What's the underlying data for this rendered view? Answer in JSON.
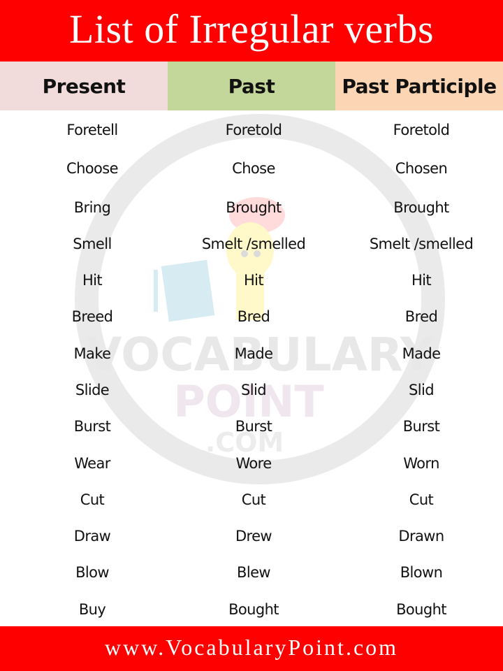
{
  "title": "List of Irregular verbs",
  "colors": {
    "banner_red": "#ff0000",
    "present_header_bg": "#f2dcdb",
    "past_header_bg": "#c4d79b",
    "past_participle_header_bg": "#fcd5b4"
  },
  "table": {
    "headers": [
      "Present",
      "Past",
      "Past Participle"
    ],
    "rows": [
      [
        "Foretell",
        "Foretold",
        "Foretold"
      ],
      [
        "Choose",
        "Chose",
        "Chosen"
      ],
      [
        "Bring",
        "Brought",
        "Brought"
      ],
      [
        "Smell",
        "Smelt /smelled",
        "Smelt /smelled"
      ],
      [
        "Hit",
        "Hit",
        "Hit"
      ],
      [
        "Breed",
        "Bred",
        "Bred"
      ],
      [
        "Make",
        "Made",
        "Made"
      ],
      [
        "Slide",
        "Slid",
        "Slid"
      ],
      [
        "Burst",
        "Burst",
        "Burst"
      ],
      [
        "Wear",
        "Wore",
        "Worn"
      ],
      [
        "Cut",
        "Cut",
        "Cut"
      ],
      [
        "Draw",
        "Drew",
        "Drawn"
      ],
      [
        "Blow",
        "Blew",
        "Blown"
      ],
      [
        "Buy",
        "Bought",
        "Bought"
      ]
    ]
  },
  "watermark": {
    "line1": "VOCABULARY",
    "line2": "POINT",
    "line3": ".COM"
  },
  "footer": {
    "url": "www.VocabularyPoint.com"
  }
}
